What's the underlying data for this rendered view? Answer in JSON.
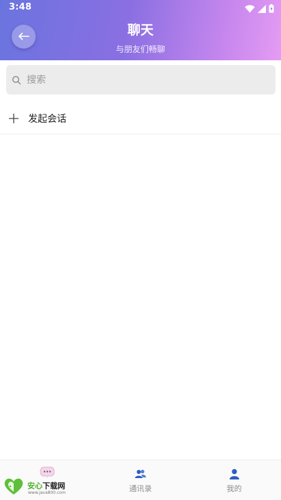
{
  "status_bar": {
    "time": "3:48"
  },
  "header": {
    "title": "聊天",
    "subtitle": "与朋友们畅聊",
    "gradient_colors": [
      "#6a74df",
      "#8a6fe2",
      "#c787ee",
      "#e59cf3"
    ]
  },
  "search": {
    "placeholder": "搜索",
    "value": ""
  },
  "start_chat": {
    "label": "发起会话"
  },
  "bottom_nav": {
    "items": [
      {
        "label": "",
        "icon": "chat-bubble-icon",
        "active": true
      },
      {
        "label": "通讯录",
        "icon": "contacts-icon",
        "active": false
      },
      {
        "label": "我的",
        "icon": "profile-icon",
        "active": false
      }
    ],
    "active_color": "#2c5cc5",
    "inactive_label_color": "#8c8c8c"
  },
  "watermark": {
    "brand_green": "安心",
    "brand_dark": "下载网",
    "url": "www.java800.com"
  }
}
